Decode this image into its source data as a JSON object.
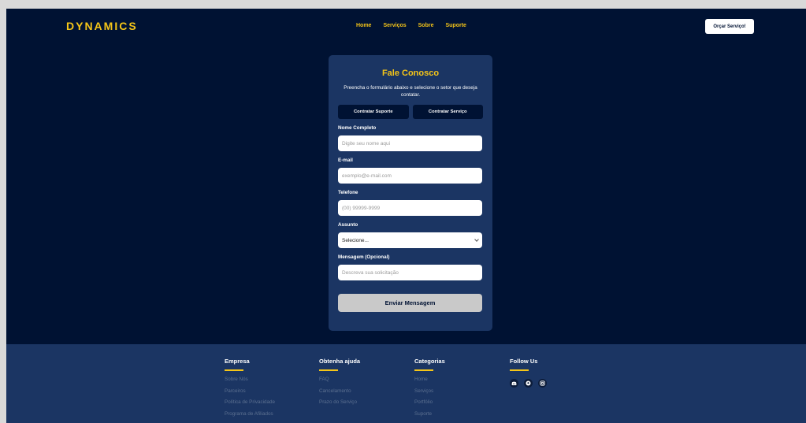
{
  "header": {
    "logo": "DYNAMICS",
    "nav": [
      "Home",
      "Serviços",
      "Sobre",
      "Suporte"
    ],
    "quote_button": "Orçar Serviço!"
  },
  "form": {
    "title": "Fale Conosco",
    "subtitle": "Preencha o formulário abaixo e selecione o setor que deseja contatar.",
    "toggle_support": "Contratar Suporte",
    "toggle_service": "Contratar Serviço",
    "name_label": "Nome Completo",
    "name_placeholder": "Digite seu nome aqui",
    "email_label": "E-mail",
    "email_placeholder": "exemplo@e-mail.com",
    "phone_label": "Telefone",
    "phone_placeholder": "(00) 99999-9999",
    "subject_label": "Assunto",
    "subject_value": "Selecione...",
    "message_label": "Mensagem (Opcional)",
    "message_placeholder": "Descreva sua solicitação",
    "submit": "Enviar Mensagem"
  },
  "footer": {
    "empresa": {
      "title": "Empresa",
      "links": [
        "Sobre Nós",
        "Parceiros",
        "Política de Privacidade",
        "Programa de Afiliados"
      ]
    },
    "ajuda": {
      "title": "Obtenha ajuda",
      "links": [
        "FAQ",
        "Cancelamento",
        "Prazo do Serviço"
      ]
    },
    "categorias": {
      "title": "Categorias",
      "links": [
        "Home",
        "Serviços",
        "Portfólio",
        "Suporte"
      ]
    },
    "follow": {
      "title": "Follow Us",
      "icons": [
        "discord-icon",
        "github-icon",
        "instagram-icon"
      ]
    }
  },
  "colors": {
    "background": "#001233",
    "accent": "#f5c518",
    "card": "#1b3563"
  }
}
